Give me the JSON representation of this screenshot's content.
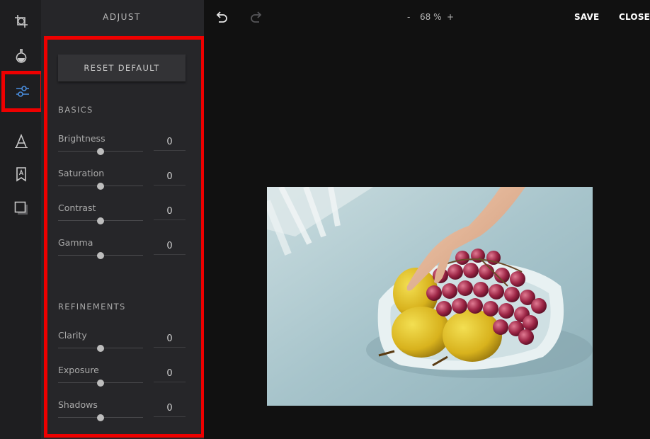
{
  "rail": {
    "tools": [
      {
        "id": "crop",
        "icon": "crop-icon",
        "active": false
      },
      {
        "id": "filter",
        "icon": "flask-icon",
        "active": false
      },
      {
        "id": "adjust",
        "icon": "sliders-icon",
        "active": true
      },
      {
        "id": "text",
        "icon": "text-icon",
        "active": false
      },
      {
        "id": "sticker",
        "icon": "bookmark-icon",
        "active": false
      },
      {
        "id": "frame",
        "icon": "frame-icon",
        "active": false
      }
    ]
  },
  "panel": {
    "title": "ADJUST",
    "reset_label": "RESET DEFAULT",
    "sections": [
      {
        "title": "BASICS",
        "sliders": [
          {
            "label": "Brightness",
            "value": "0"
          },
          {
            "label": "Saturation",
            "value": "0"
          },
          {
            "label": "Contrast",
            "value": "0"
          },
          {
            "label": "Gamma",
            "value": "0"
          }
        ]
      },
      {
        "title": "REFINEMENTS",
        "sliders": [
          {
            "label": "Clarity",
            "value": "0"
          },
          {
            "label": "Exposure",
            "value": "0"
          },
          {
            "label": "Shadows",
            "value": "0"
          }
        ]
      }
    ]
  },
  "topbar": {
    "zoom_minus": "-",
    "zoom_value": "68 %",
    "zoom_plus": "+",
    "save_label": "SAVE",
    "close_label": "CLOSE"
  },
  "colors": {
    "highlight": "#ee0000",
    "active_icon": "#4a8fe0",
    "background": "#111111",
    "panel": "#262629"
  }
}
